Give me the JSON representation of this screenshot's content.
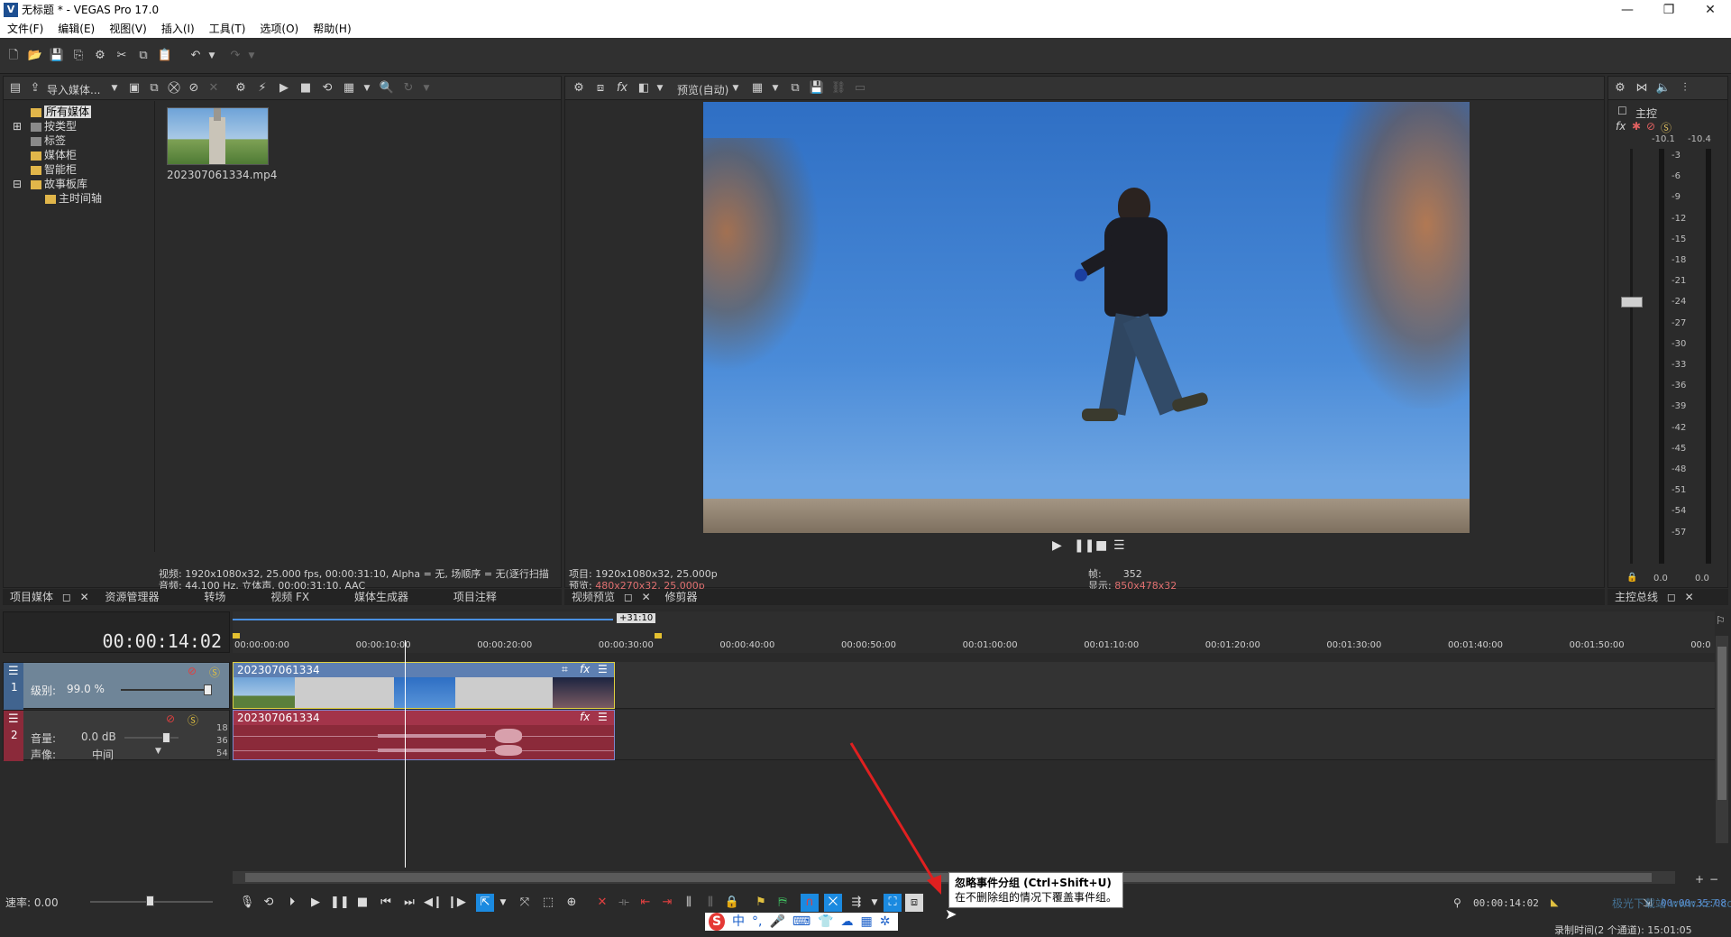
{
  "window": {
    "title": "无标题 * - VEGAS Pro 17.0",
    "logo_letter": "V",
    "controls": [
      "—",
      "❐",
      "✕"
    ]
  },
  "menu": [
    "文件(F)",
    "编辑(E)",
    "视图(V)",
    "插入(I)",
    "工具(T)",
    "选项(O)",
    "帮助(H)"
  ],
  "media_panel": {
    "import_label": "导入媒体...",
    "tree": [
      {
        "label": "所有媒体",
        "selected": true,
        "indent": 1,
        "icon": "folder-icon"
      },
      {
        "label": "按类型",
        "indent": 1,
        "expander": "⊞",
        "icon": "folder-icon"
      },
      {
        "label": "标签",
        "indent": 1,
        "icon": "folder-icon"
      },
      {
        "label": "媒体柜",
        "indent": 1,
        "icon": "folder-icon"
      },
      {
        "label": "智能柜",
        "indent": 1,
        "icon": "folder-icon"
      },
      {
        "label": "故事板库",
        "indent": 1,
        "expander": "⊟",
        "icon": "folder-icon"
      },
      {
        "label": "主时间轴",
        "indent": 2,
        "icon": "folder-icon"
      }
    ],
    "thumb_name": "202307061334.mp4",
    "info_video": "视频: 1920x1080x32, 25.000 fps, 00:00:31:10, Alpha = 无, 场顺序 = 无(逐行扫描",
    "info_audio": "音频: 44,100 Hz, 立体声, 00:00:31:10, AAC"
  },
  "bottom_tabs_left": [
    "项目媒体",
    "资源管理器",
    "转场",
    "视频 FX",
    "媒体生成器",
    "项目注释"
  ],
  "preview": {
    "quality_label": "预览(自动)",
    "project_info": "项目: 1920x1080x32, 25.000p",
    "preview_label": "预览: ",
    "preview_value": "480x270x32, 25.000p",
    "frame_label": "帧:",
    "frame_value": "352",
    "display_label": "显示: ",
    "display_value": "850x478x32",
    "tabs": [
      "视频预览",
      "修剪器"
    ]
  },
  "master": {
    "label": "主控",
    "peak_left": "-10.1",
    "peak_right": "-10.4",
    "ticks": [
      "-3",
      "-6",
      "-9",
      "-12",
      "-15",
      "-18",
      "-21",
      "-24",
      "-27",
      "-30",
      "-33",
      "-36",
      "-39",
      "-42",
      "-45",
      "-48",
      "-51",
      "-54",
      "-57"
    ],
    "bottom_left": "0.0",
    "bottom_right": "0.0",
    "tab": "主控总线"
  },
  "timeline": {
    "timecode": "00:00:14:02",
    "loop_label": "+31:10",
    "ruler": [
      "00:00:00:00",
      "00:00:10:00",
      "00:00:20:00",
      "00:00:30:00",
      "00:00:40:00",
      "00:00:50:00",
      "00:01:00:00",
      "00:01:10:00",
      "00:01:20:00",
      "00:01:30:00",
      "00:01:40:00",
      "00:01:50:00",
      "00:0"
    ],
    "video_track": {
      "number": "1",
      "level_label": "级别:",
      "level_value": "99.0 %",
      "clip_name": "202307061334"
    },
    "audio_track": {
      "number": "2",
      "volume_label": "音量:",
      "volume_value": "0.0 dB",
      "pan_label": "声像:",
      "pan_value": "中间",
      "clip_name": "202307061334",
      "db_ticks": [
        "18",
        "36",
        "54"
      ]
    },
    "rate_label": "速率: 0.00",
    "cursor_time": "00:00:14:02",
    "end_time": "00:00:35:08",
    "record_time": "录制时间(2 个通道): 15:01:05"
  },
  "tooltip": {
    "title": "忽略事件分组 (Ctrl+Shift+U)",
    "body": "在不删除组的情况下覆盖事件组。"
  },
  "ime": [
    "S",
    "中",
    "°,",
    "🎤",
    "⌨",
    "👕",
    "☁",
    "▦",
    "✲"
  ],
  "watermark": "极光下载站 www.xz7.com"
}
